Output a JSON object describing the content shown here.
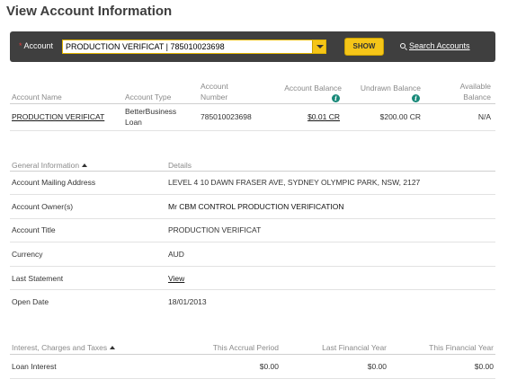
{
  "page": {
    "title": "View Account Information"
  },
  "account_selector": {
    "label": "Account",
    "selected": "PRODUCTION VERIFICAT | 785010023698",
    "show_label": "SHOW",
    "search_label": "Search Accounts"
  },
  "summary": {
    "headers": {
      "name": "Account Name",
      "type": "Account Type",
      "number_line1": "Account",
      "number_line2": "Number",
      "balance": "Account Balance",
      "undrawn": "Undrawn Balance",
      "available_line1": "Available",
      "available_line2": "Balance"
    },
    "row": {
      "name": "PRODUCTION VERIFICAT",
      "type_line1": "BetterBusiness",
      "type_line2": "Loan",
      "number": "785010023698",
      "balance": "$0.01 CR",
      "undrawn": "$200.00 CR",
      "available": "N/A"
    }
  },
  "general": {
    "header": "General Information",
    "details_header": "Details",
    "rows": [
      {
        "label": "Account Mailing Address",
        "value": "LEVEL 4 10 DAWN FRASER AVE, SYDNEY OLYMPIC PARK, NSW, 2127"
      },
      {
        "label": "Account Owner(s)",
        "value": "Mr CBM CONTROL PRODUCTION VERIFICATION"
      },
      {
        "label": "Account Title",
        "value": "PRODUCTION VERIFICAT"
      },
      {
        "label": "Currency",
        "value": "AUD"
      },
      {
        "label": "Last Statement",
        "value": "View"
      },
      {
        "label": "Open Date",
        "value": "18/01/2013"
      }
    ]
  },
  "interest": {
    "header": "Interest, Charges and Taxes",
    "col1": "This Accrual Period",
    "col2": "Last Financial Year",
    "col3": "This Financial Year",
    "rows": [
      {
        "label": "Loan Interest",
        "v1": "$0.00",
        "v2": "$0.00",
        "v3": "$0.00"
      }
    ]
  }
}
